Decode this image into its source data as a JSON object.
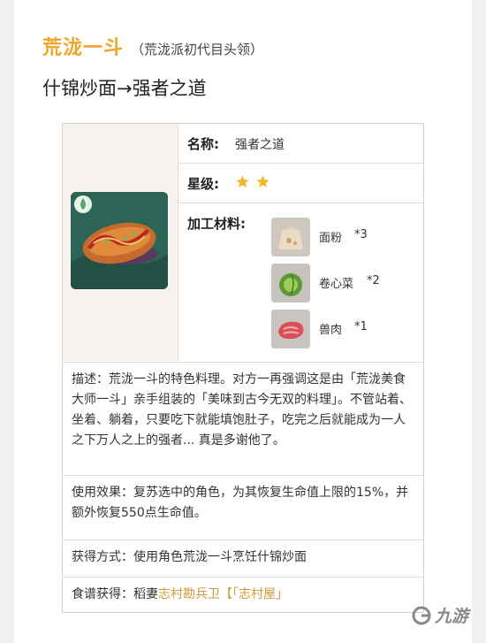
{
  "character": {
    "name": "荒泷一斗",
    "role": "（荒泷派初代目头领）"
  },
  "dish_title": "什锦炒面→强者之道",
  "card": {
    "name_label": "名称:",
    "name_value": "强者之道",
    "star_label": "星级:",
    "stars": 2,
    "materials_label": "加工材料:",
    "materials": [
      {
        "name": "面粉",
        "qty": "*3",
        "icon": "flour-sack-icon"
      },
      {
        "name": "卷心菜",
        "qty": "*2",
        "icon": "cabbage-icon"
      },
      {
        "name": "兽肉",
        "qty": "*1",
        "icon": "raw-meat-icon"
      }
    ],
    "description": "描述：荒泷一斗的特色料理。对方一再强调这是由「荒泷美食大师一斗」亲手组装的「美味到古今无双的料理」。不管站着、坐着、躺着，只要吃下就能填饱肚子，吃完之后就能成为一人之下万人之上的强者... 真是多谢他了。",
    "effect": "使用效果：复苏选中的角色，为其恢复生命值上限的15%，并额外恢复550点生命值。",
    "obtain": "获得方式：使用角色荒泷一斗烹饪什锦炒面",
    "recipe_label": "食谱获得：稻妻",
    "recipe_link": "志村勘兵卫【「志村屋」",
    "colors": {
      "accent_orange": "#f0a52a",
      "link": "#d39a3a",
      "star": "#f0b82c"
    }
  },
  "watermark": {
    "text": "九游",
    "icon": "jiuyou-logo-icon"
  }
}
